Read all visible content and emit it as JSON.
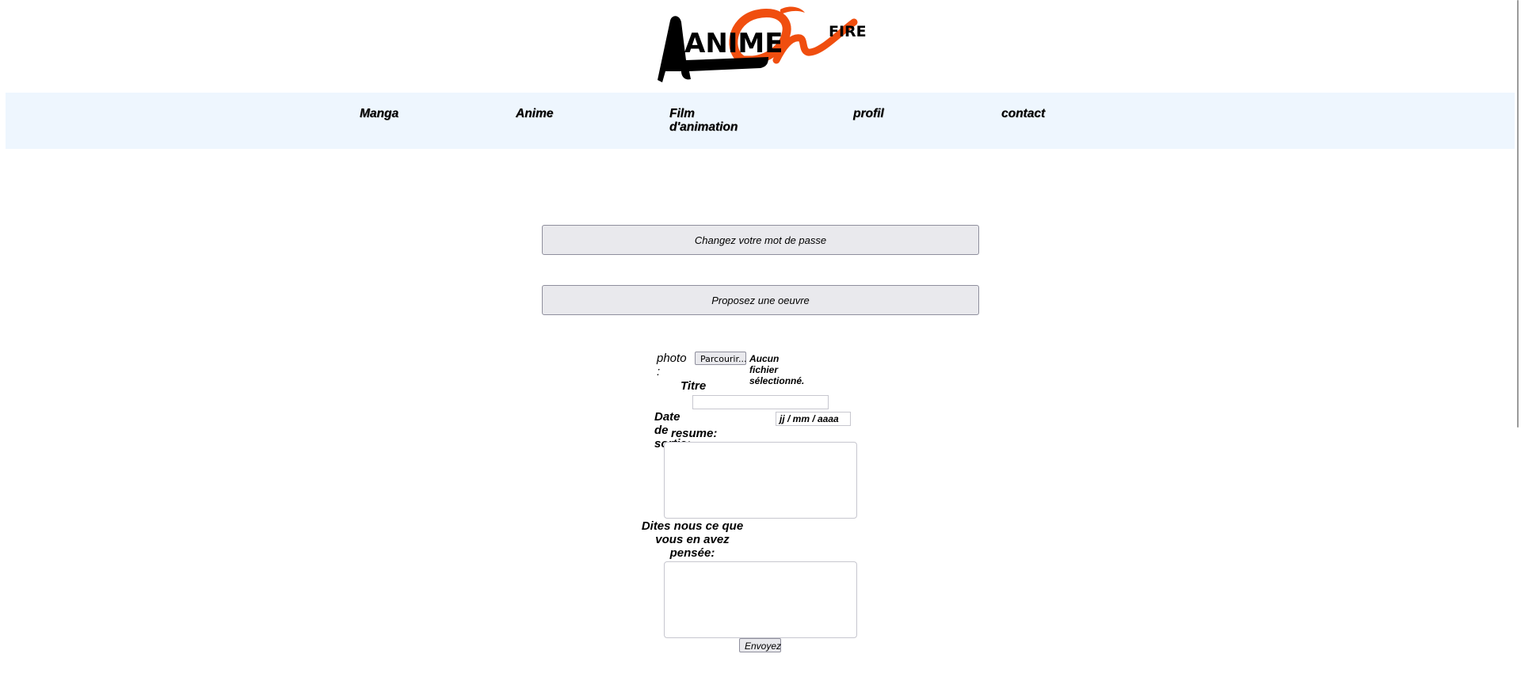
{
  "logo": {
    "text_anime": "ANIME",
    "text_on": "ON",
    "text_fire": "FIRE"
  },
  "nav": {
    "items": [
      {
        "label": "Manga"
      },
      {
        "label": "Anime"
      },
      {
        "label": "Film d'animation"
      },
      {
        "label": "profil"
      },
      {
        "label": "contact"
      }
    ]
  },
  "profile_actions": {
    "change_password": "Changez votre mot de passe",
    "propose_work": "Proposez une oeuvre"
  },
  "form": {
    "photo_label": "photo :",
    "browse_button": "Parcourir...",
    "no_file": "Aucun fichier sélectionné.",
    "title_label": "Titre",
    "title_value": "",
    "release_label": "Date de sortie:",
    "release_placeholder": "jj / mm / aaaa",
    "summary_label": "resume:",
    "summary_value": "",
    "opinion_label": "Dites nous ce que vous en avez pensée:",
    "opinion_value": "",
    "submit": "Envoyez"
  },
  "colors": {
    "nav_bg": "#eef6fe",
    "logo_orange": "#f04e0f",
    "button_bg": "#e9e9ed"
  }
}
